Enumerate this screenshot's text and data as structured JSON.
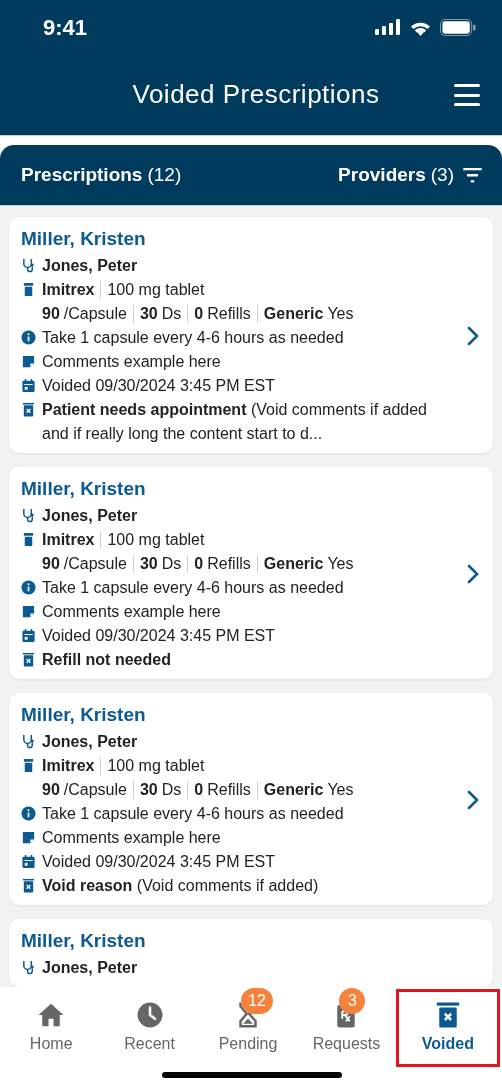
{
  "status_bar": {
    "time": "9:41"
  },
  "header": {
    "title": "Voided Prescriptions"
  },
  "list_header": {
    "label": "Prescriptions",
    "count": "(12)",
    "filter_label": "Providers",
    "filter_count": "(3)"
  },
  "prescriptions": [
    {
      "patient": "Miller, Kristen",
      "provider": "Jones, Peter",
      "drug": "Imitrex",
      "strength": "100 mg tablet",
      "qty": "90",
      "unit": "/Capsule",
      "days": "30",
      "days_label": "Ds",
      "refills": "0",
      "refills_label": "Refills",
      "generic_label": "Generic",
      "generic": "Yes",
      "instructions": "Take 1 capsule every 4-6 hours as needed",
      "comment": "Comments example here",
      "voided": "Voided 09/30/2024 3:45 PM EST",
      "void_reason": "**Patient needs appointment** (Void comments if added and if really long the content start to d..."
    },
    {
      "patient": "Miller, Kristen",
      "provider": "Jones, Peter",
      "drug": "Imitrex",
      "strength": "100 mg tablet",
      "qty": "90",
      "unit": "/Capsule",
      "days": "30",
      "days_label": "Ds",
      "refills": "0",
      "refills_label": "Refills",
      "generic_label": "Generic",
      "generic": "Yes",
      "instructions": "Take 1 capsule every 4-6 hours as needed",
      "comment": "Comments example here",
      "voided": "Voided 09/30/2024 3:45 PM EST",
      "void_reason": "**Refill not needed**"
    },
    {
      "patient": "Miller, Kristen",
      "provider": "Jones, Peter",
      "drug": "Imitrex",
      "strength": "100 mg tablet",
      "qty": "90",
      "unit": "/Capsule",
      "days": "30",
      "days_label": "Ds",
      "refills": "0",
      "refills_label": "Refills",
      "generic_label": "Generic",
      "generic": "Yes",
      "instructions": "Take 1 capsule every 4-6 hours as needed",
      "comment": "Comments example here",
      "voided": "Voided 09/30/2024 3:45 PM EST",
      "void_reason": "**Void reason** (Void comments if added)"
    },
    {
      "patient": "Miller, Kristen",
      "provider": "Jones, Peter"
    }
  ],
  "tab_bar": [
    {
      "kind": "home",
      "label": "Home",
      "selected": false
    },
    {
      "kind": "recent",
      "label": "Recent",
      "selected": false
    },
    {
      "kind": "pending",
      "label": "Pending",
      "badge": "12",
      "selected": false
    },
    {
      "kind": "requests",
      "label": "Requests",
      "badge": "3",
      "selected": false
    },
    {
      "kind": "voided",
      "label": "Voided",
      "selected": true
    }
  ]
}
